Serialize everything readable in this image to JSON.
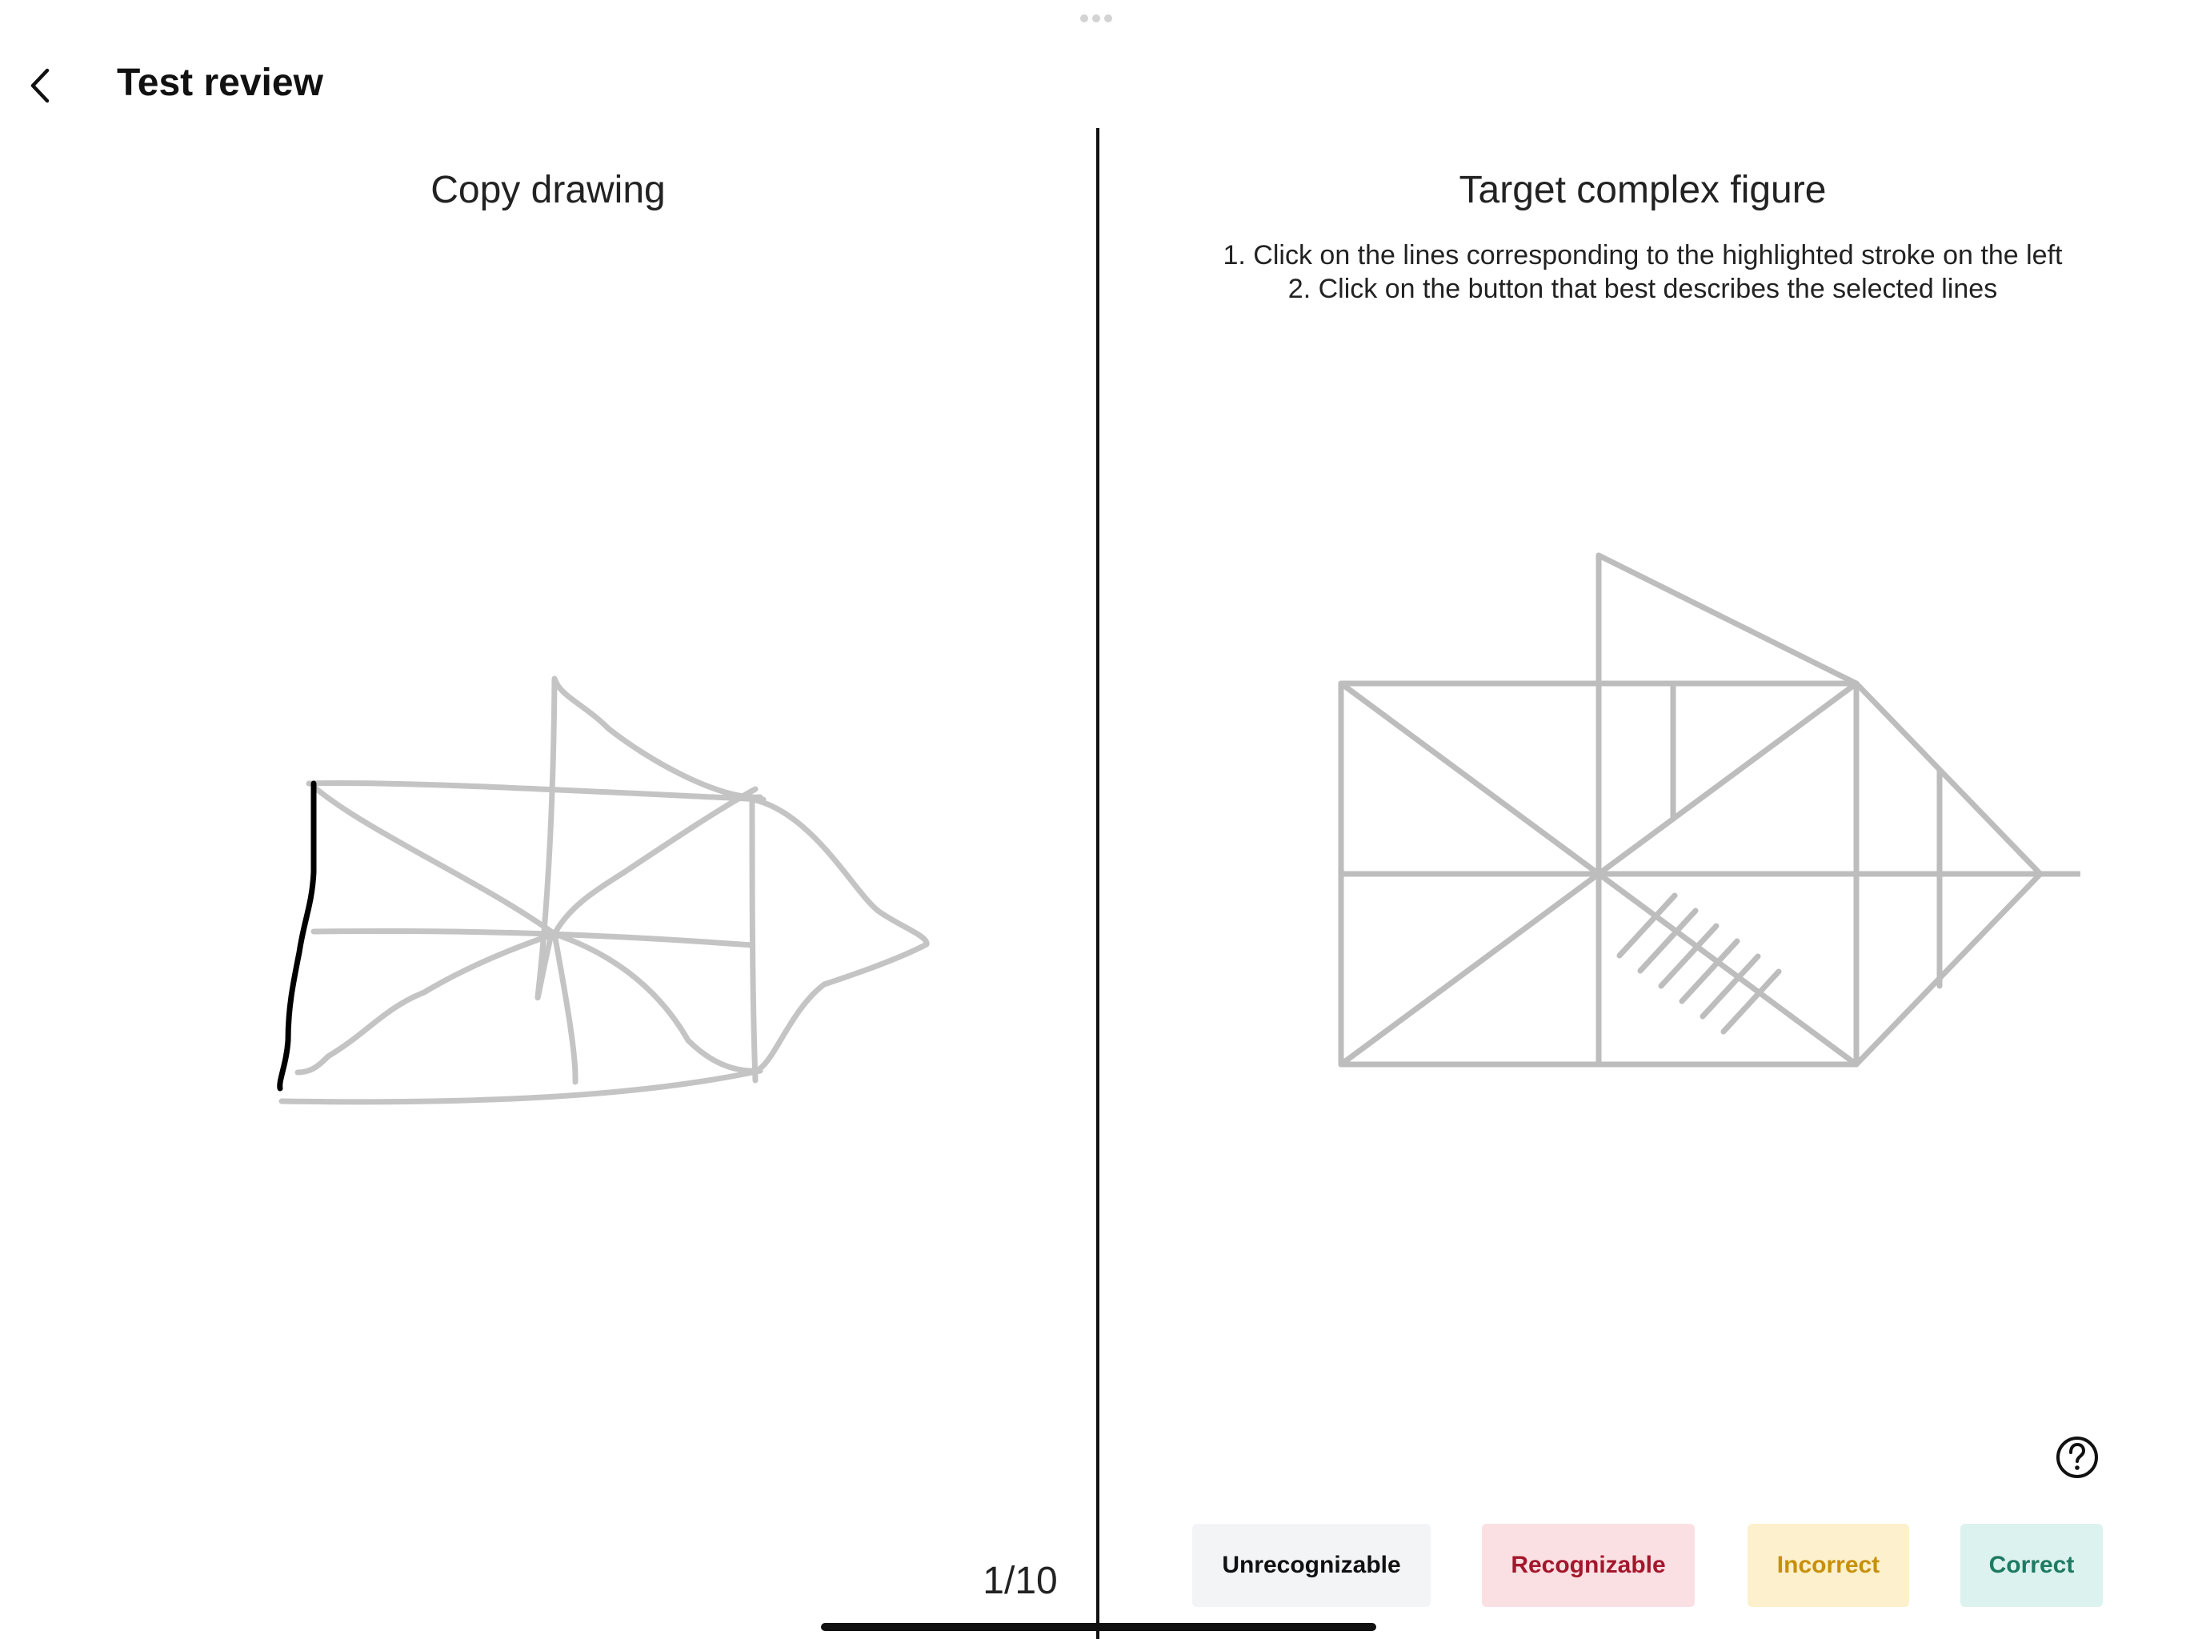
{
  "header": {
    "title": "Test review",
    "back_icon": "chevron-left-icon"
  },
  "left_panel": {
    "heading": "Copy drawing"
  },
  "right_panel": {
    "heading": "Target complex figure",
    "instructions": [
      "1. Click on the lines corresponding to the highlighted stroke on the left",
      "2. Click on the button that best describes the selected lines"
    ]
  },
  "help": {
    "icon": "question-circle-icon"
  },
  "rating_buttons": [
    {
      "label": "Unrecognizable",
      "bg": "#f3f4f6",
      "color": "#111111"
    },
    {
      "label": "Recognizable",
      "bg": "#fbe0e3",
      "color": "#a3172c"
    },
    {
      "label": "Incorrect",
      "bg": "#fdf0cc",
      "color": "#c8900a"
    },
    {
      "label": "Correct",
      "bg": "#dcf2ee",
      "color": "#1d7a63"
    }
  ],
  "pager": {
    "text": "1/10"
  },
  "colors": {
    "stroke_faded": "#c4c4c4",
    "stroke_highlight": "#000000",
    "figure_lines": "#bdbdbd"
  }
}
